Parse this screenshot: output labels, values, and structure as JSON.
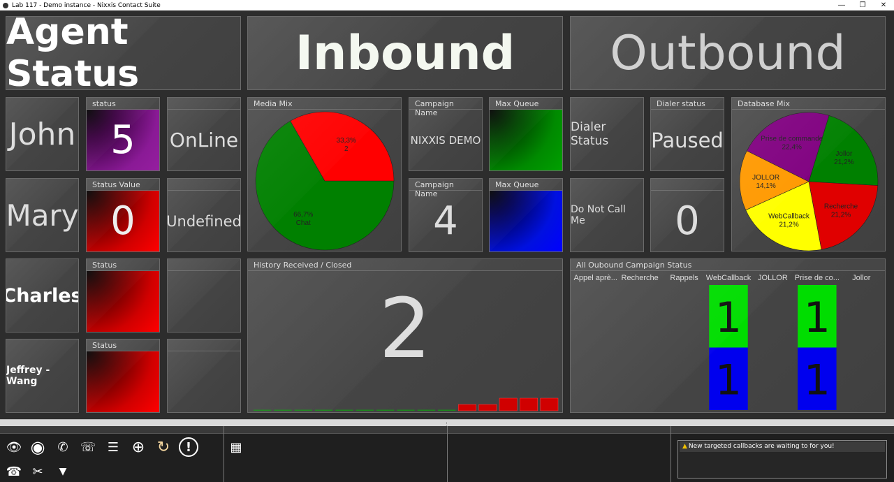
{
  "window": {
    "title": "Lab 117 - Demo instance - Nixxis Contact Suite",
    "minimize": "—",
    "restore": "❐",
    "close": "✕"
  },
  "sections": {
    "agent": "Agent Status",
    "inbound": "Inbound",
    "outbound": "Outbound"
  },
  "agents": [
    {
      "name": "John",
      "header": "status",
      "value": "5",
      "state": "OnLine"
    },
    {
      "name": "Mary",
      "header": "Status Value",
      "value": "0",
      "state": "Undefined"
    },
    {
      "name": "Charles",
      "header": "Status",
      "value": "",
      "state": ""
    },
    {
      "name": "Jeffrey - Wang",
      "header": "Status",
      "value": "",
      "state": ""
    }
  ],
  "inbound": {
    "media_mix_header": "Media Mix",
    "campaign1_header": "Campaign Name",
    "campaign1_value": "NIXXIS DEMO",
    "queue1_header": "Max Queue Time",
    "campaign2_header": "Campaign Name",
    "campaign2_value": "4",
    "queue2_header": "Max Queue Time",
    "history_header": "History Received / Closed",
    "history_value": "2"
  },
  "outbound": {
    "dialer_status_label": "Dialer Status",
    "dialer_header": "Dialer status",
    "dialer_value": "Paused",
    "dnc_label": "Do Not Call Me",
    "dnc_value": "0",
    "db_mix_header": "Database Mix",
    "campaign_status_header": "All Oubound Campaign Status"
  },
  "chart_data": [
    {
      "type": "pie",
      "title": "Media Mix",
      "slices": [
        {
          "label": "Chat",
          "value": 66.7,
          "display": "66,7%",
          "count_label": "",
          "color": "#008000"
        },
        {
          "label": "",
          "value": 33.3,
          "display": "33,3%",
          "count_label": "2",
          "color": "#ff0000"
        }
      ]
    },
    {
      "type": "pie",
      "title": "Database Mix",
      "slices": [
        {
          "label": "Jollor",
          "value": 21.2,
          "display": "21,2%",
          "color": "#008000"
        },
        {
          "label": "Recherche",
          "value": 21.2,
          "display": "21,2%",
          "color": "#e00000"
        },
        {
          "label": "WebCallback",
          "value": 21.2,
          "display": "21,2%",
          "color": "#ffff00"
        },
        {
          "label": "JOLLOR",
          "value": 14.1,
          "display": "14,1%",
          "color": "#ff9900"
        },
        {
          "label": "Prise de commande",
          "value": 22.4,
          "display": "22,4%",
          "color": "#800080"
        }
      ]
    },
    {
      "type": "bar",
      "title": "History Received / Closed",
      "values": [
        0,
        0,
        0,
        0,
        0,
        0,
        0,
        0,
        0,
        0,
        1,
        1,
        2,
        2,
        2
      ],
      "ylim": [
        0,
        2
      ]
    },
    {
      "type": "bar",
      "title": "All Oubound Campaign Status",
      "categories": [
        "Appel aprè...",
        "Recherche",
        "Rappels",
        "WebCallback",
        "JOLLOR",
        "Prise de co...",
        "Jollor"
      ],
      "series": [
        {
          "color": "#00dd00",
          "values": [
            0,
            0,
            0,
            1,
            0,
            1,
            0
          ]
        },
        {
          "color": "#0000ee",
          "values": [
            0,
            0,
            0,
            1,
            0,
            1,
            0
          ]
        }
      ],
      "ylim": [
        0,
        2
      ]
    }
  ],
  "status_bar": {
    "notification": "New targeted callbacks are waiting to for you!"
  },
  "toolbar": [
    {
      "icon": "eye-icon",
      "glyph": "👁"
    },
    {
      "icon": "refresh-circle-icon",
      "glyph": "◉"
    },
    {
      "icon": "phone-wave-icon",
      "glyph": "✆"
    },
    {
      "icon": "phone-transfer-icon",
      "glyph": "☏"
    },
    {
      "icon": "database-icon",
      "glyph": "☰"
    },
    {
      "icon": "target-icon",
      "glyph": "⊕"
    },
    {
      "icon": "callback-icon",
      "glyph": "↻"
    },
    {
      "icon": "alert-icon",
      "glyph": "!"
    },
    {
      "icon": "telephone-icon",
      "glyph": "☎"
    },
    {
      "icon": "tools-icon",
      "glyph": "✂"
    },
    {
      "icon": "filter-icon",
      "glyph": "▼"
    },
    {
      "icon": "table-icon",
      "glyph": "▦"
    }
  ]
}
